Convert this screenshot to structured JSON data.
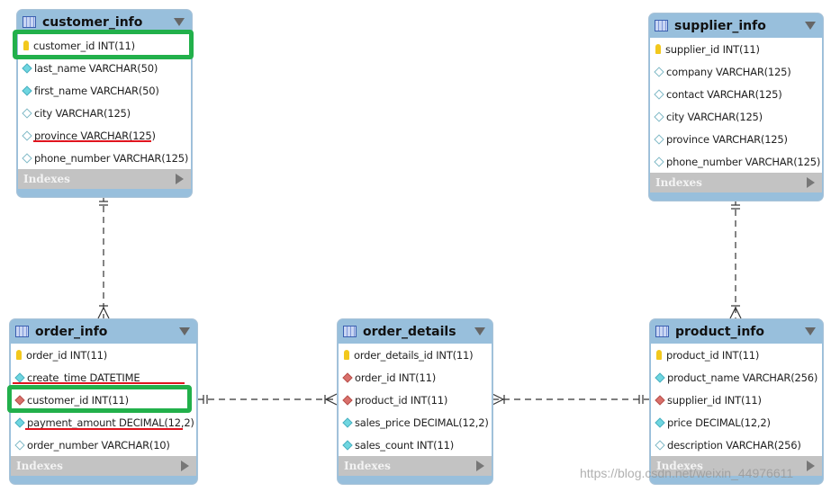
{
  "tables": {
    "customer_info": {
      "title": "customer_info",
      "indexes": "Indexes",
      "columns": [
        {
          "text": "customer_id INT(11)",
          "kind": "primary-key"
        },
        {
          "text": "last_name VARCHAR(50)",
          "kind": "not-null"
        },
        {
          "text": "first_name VARCHAR(50)",
          "kind": "not-null"
        },
        {
          "text": "city VARCHAR(125)",
          "kind": "nullable"
        },
        {
          "text": "province VARCHAR(125)",
          "kind": "nullable"
        },
        {
          "text": "phone_number VARCHAR(125)",
          "kind": "nullable"
        }
      ]
    },
    "supplier_info": {
      "title": "supplier_info",
      "indexes": "Indexes",
      "columns": [
        {
          "text": "supplier_id INT(11)",
          "kind": "primary-key"
        },
        {
          "text": "company VARCHAR(125)",
          "kind": "nullable"
        },
        {
          "text": "contact VARCHAR(125)",
          "kind": "nullable"
        },
        {
          "text": "city VARCHAR(125)",
          "kind": "nullable"
        },
        {
          "text": "province VARCHAR(125)",
          "kind": "nullable"
        },
        {
          "text": "phone_number VARCHAR(125)",
          "kind": "nullable"
        }
      ]
    },
    "order_info": {
      "title": "order_info",
      "indexes": "Indexes",
      "columns": [
        {
          "text": "order_id INT(11)",
          "kind": "primary-key"
        },
        {
          "text": "create_time DATETIME",
          "kind": "not-null"
        },
        {
          "text": "customer_id INT(11)",
          "kind": "foreign-key"
        },
        {
          "text": "payment_amount DECIMAL(12,2)",
          "kind": "not-null"
        },
        {
          "text": "order_number VARCHAR(10)",
          "kind": "nullable"
        }
      ]
    },
    "order_details": {
      "title": "order_details",
      "indexes": "Indexes",
      "columns": [
        {
          "text": "order_details_id INT(11)",
          "kind": "primary-key"
        },
        {
          "text": "order_id INT(11)",
          "kind": "foreign-key"
        },
        {
          "text": "product_id INT(11)",
          "kind": "foreign-key"
        },
        {
          "text": "sales_price DECIMAL(12,2)",
          "kind": "not-null"
        },
        {
          "text": "sales_count INT(11)",
          "kind": "not-null"
        }
      ]
    },
    "product_info": {
      "title": "product_info",
      "indexes": "Indexes",
      "columns": [
        {
          "text": "product_id INT(11)",
          "kind": "primary-key"
        },
        {
          "text": "product_name VARCHAR(256)",
          "kind": "not-null"
        },
        {
          "text": "supplier_id INT(11)",
          "kind": "foreign-key"
        },
        {
          "text": "price DECIMAL(12,2)",
          "kind": "not-null"
        },
        {
          "text": "description VARCHAR(256)",
          "kind": "nullable"
        }
      ]
    }
  },
  "relationships": [
    {
      "from": "customer_info",
      "to": "order_info",
      "type": "one-to-many"
    },
    {
      "from": "supplier_info",
      "to": "product_info",
      "type": "one-to-many"
    },
    {
      "from": "order_info",
      "to": "order_details",
      "type": "one-to-many"
    },
    {
      "from": "product_info",
      "to": "order_details",
      "type": "one-to-many"
    }
  ],
  "annotations": {
    "highlight_color": "#22b04b",
    "underline_color": "#e0141e"
  },
  "watermark": "https://blog.csdn.net/weixin_44976611"
}
